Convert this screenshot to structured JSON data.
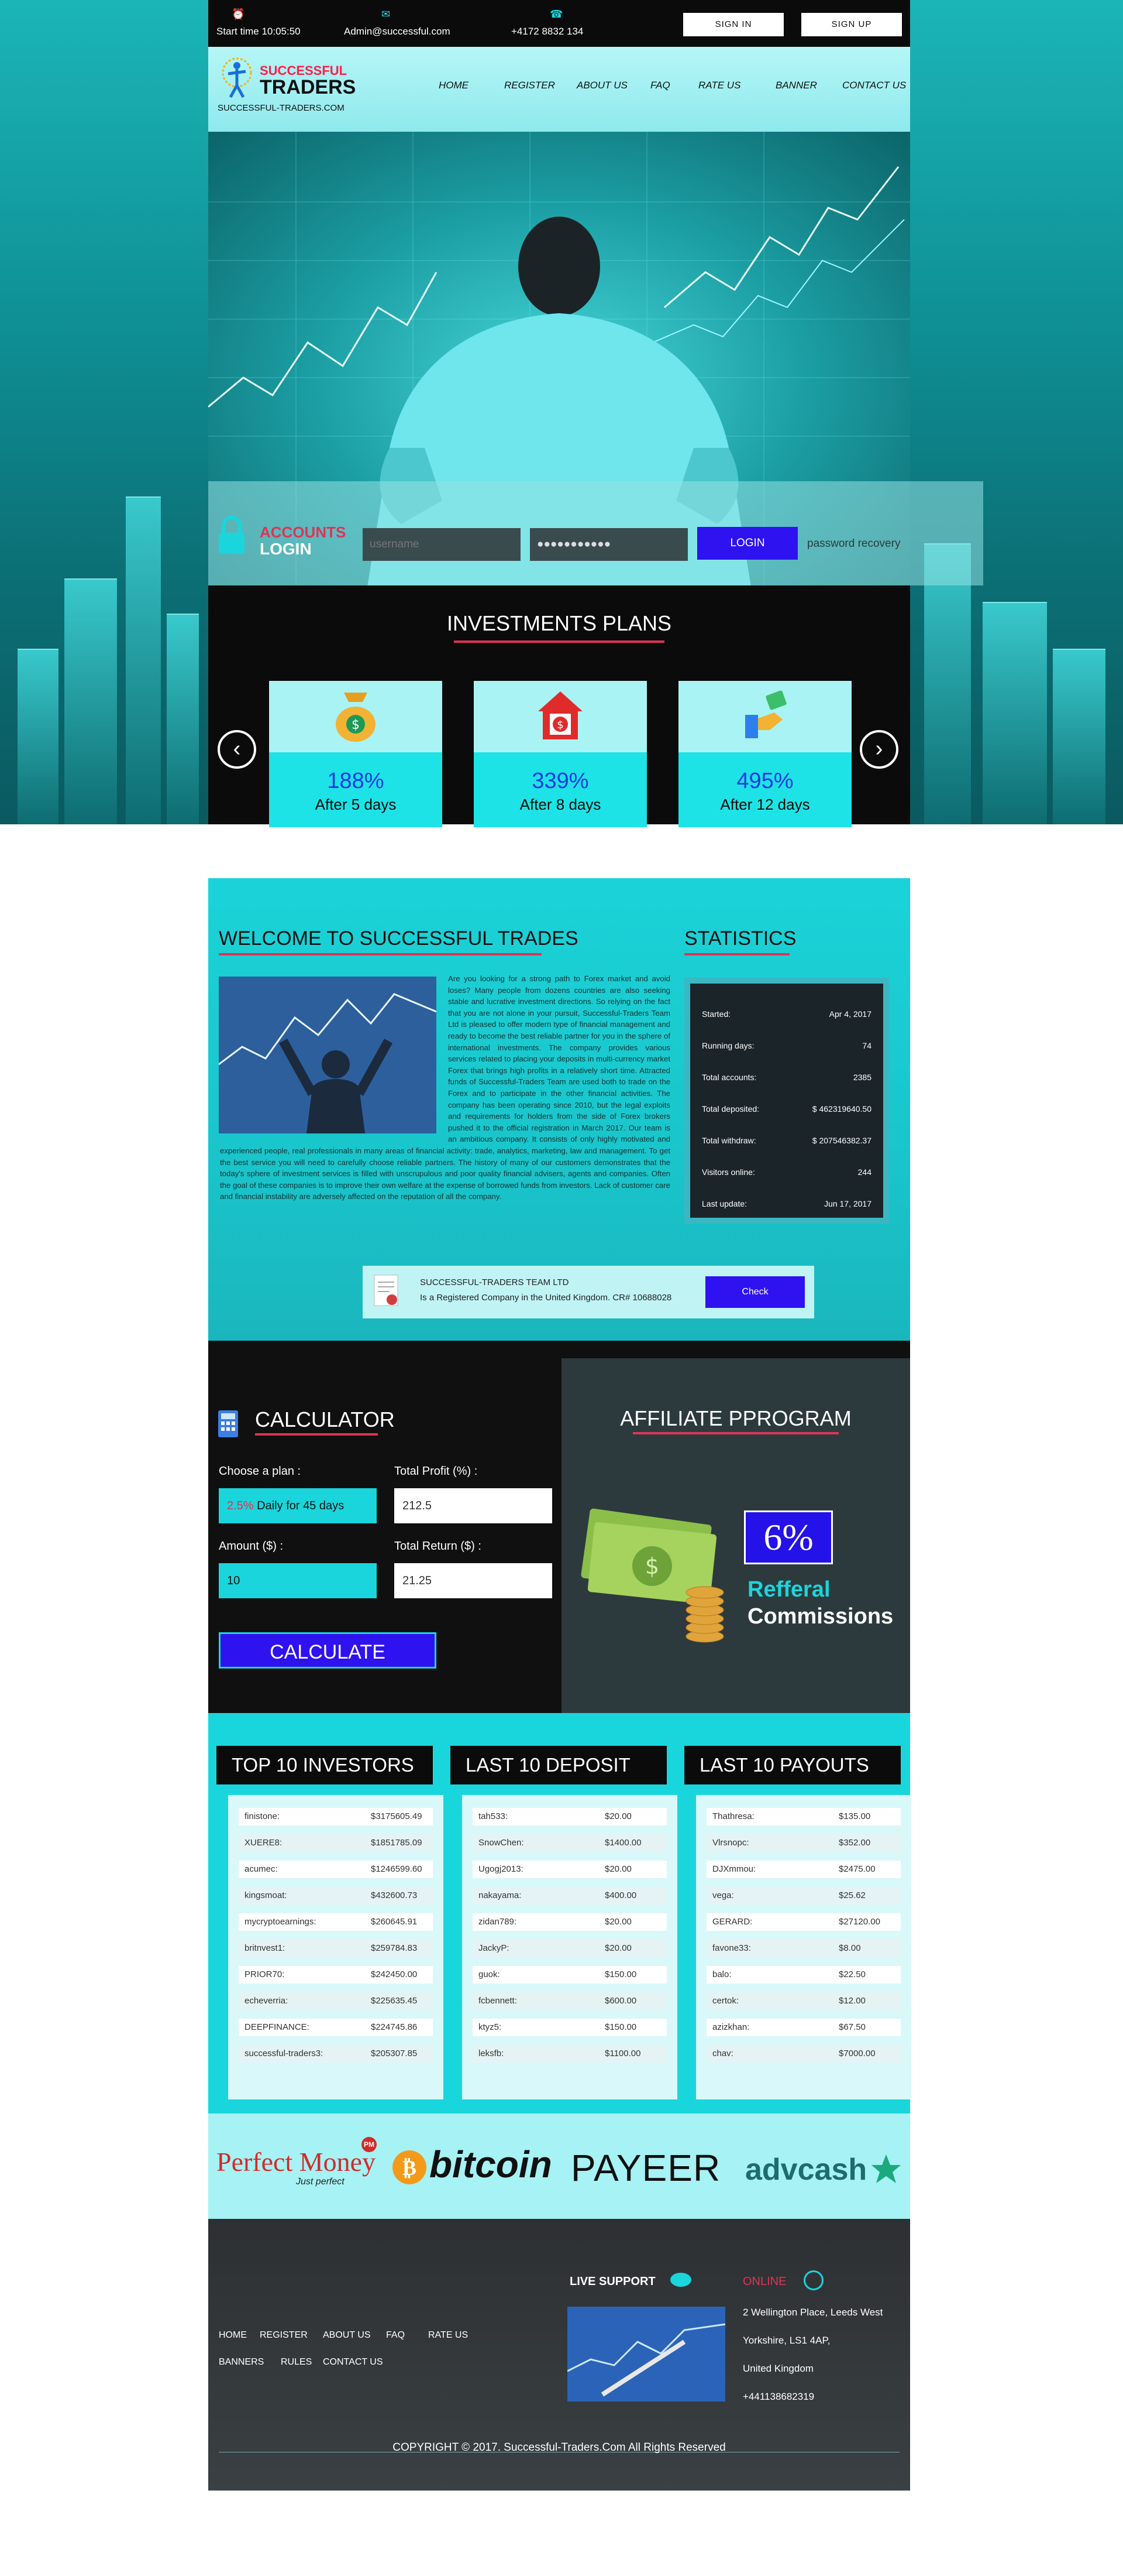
{
  "topbar": {
    "start_time": "Start time 10:05:50",
    "email": "Admin@successful.com",
    "phone": "+4172 8832 134",
    "sign_in": "SIGN IN",
    "sign_up": "SIGN UP"
  },
  "brand": {
    "line1": "SUCCESSFUL",
    "line2": "TRADERS",
    "url": "SUCCESSFUL-TRADERS.COM"
  },
  "nav": [
    "HOME",
    "REGISTER",
    "ABOUT US",
    "FAQ",
    "RATE US",
    "BANNER",
    "CONTACT US"
  ],
  "login": {
    "label1": "ACCOUNTS",
    "label2": "LOGIN",
    "username_placeholder": "username",
    "password_value": "●●●●●●●●●●●",
    "button": "LOGIN",
    "recovery": "password recovery"
  },
  "plans": {
    "title": "INVESTMENTS PLANS",
    "items": [
      {
        "percent": "188%",
        "days": "After 5 days",
        "icon": "money-bag-icon"
      },
      {
        "percent": "339%",
        "days": "After 8 days",
        "icon": "house-dollar-icon"
      },
      {
        "percent": "495%",
        "days": "After 12 days",
        "icon": "hand-money-icon"
      }
    ]
  },
  "welcome": {
    "title": "WELCOME TO SUCCESSFUL TRADES",
    "body": "Are you looking for a strong path to Forex market and avoid loses? Many people from dozens countries are also seeking stable and lucrative investment directions. So relying on the fact that you are not alone in your pursuit, Successful-Traders Team Ltd is pleased to offer modern type of financial management and ready to become the best reliable partner for you in the sphere of international investments. The company provides various services related to placing your deposits in multi-currency market Forex that brings high profits in a relatively short time. Attracted funds of Successful-Traders Team are used both to trade on the Forex and to participate in the other financial activities. The company has been operating since 2010, but the legal exploits and requirements for holders from the side of Forex brokers pushed it to the official registration in March 2017. Our team is an ambitious company. It consists of only highly motivated and experienced people, real professionals in many areas of financial activity: trade, analytics, marketing, law and management. To get the best service you will need to carefully choose reliable partners. The history of many of our customers demonstrates that the today's sphere of investment services is filled with unscrupulous and poor quality financial advisers, agents and companies. Often the goal of these companies is to improve their own welfare at the expense of borrowed funds from investors. Lack of customer care and financial instability are adversely affected on the reputation of all the company."
  },
  "statistics": {
    "title": "STATISTICS",
    "rows": [
      {
        "label": "Started:",
        "value": "Apr 4, 2017"
      },
      {
        "label": "Running days:",
        "value": "74"
      },
      {
        "label": "Total accounts:",
        "value": "2385"
      },
      {
        "label": "Total deposited:",
        "value": "$ 462319640.50"
      },
      {
        "label": "Total withdraw:",
        "value": "$ 207546382.37"
      },
      {
        "label": "Visitors online:",
        "value": "244"
      },
      {
        "label": "Last update:",
        "value": "Jun 17, 2017"
      }
    ]
  },
  "registration": {
    "company": "SUCCESSFUL-TRADERS TEAM LTD",
    "text": "Is a Registered Company in the United Kingdom. CR# 10688028",
    "button": "Check"
  },
  "calculator": {
    "title": "CALCULATOR",
    "plan_label": "Choose a plan :",
    "plan_pct": "2.5%",
    "plan_value": "Daily for 45 days",
    "profit_label": "Total Profit (%) :",
    "profit_value": "212.5",
    "amount_label": "Amount ($) :",
    "amount_value": "10",
    "return_label": "Total Return ($) :",
    "return_value": "21.25",
    "button": "CALCULATE"
  },
  "affiliate": {
    "title": "AFFILIATE PPROGRAM",
    "percent": "6%",
    "line1": "Refferal",
    "line2": "Commissions"
  },
  "investors": {
    "title": "TOP 10 INVESTORS",
    "rows": [
      [
        "finistone:",
        "$3175605.49"
      ],
      [
        "XUERE8:",
        "$1851785.09"
      ],
      [
        "acumec:",
        "$1246599.60"
      ],
      [
        "kingsmoat:",
        "$432600.73"
      ],
      [
        "mycryptoearnings:",
        "$260645.91"
      ],
      [
        "britnvest1:",
        "$259784.83"
      ],
      [
        "PRIOR70:",
        "$242450.00"
      ],
      [
        "echeverria:",
        "$225635.45"
      ],
      [
        "DEEPFINANCE:",
        "$224745.86"
      ],
      [
        "successful-traders3:",
        "$205307.85"
      ]
    ]
  },
  "deposits": {
    "title": "LAST 10 DEPOSIT",
    "rows": [
      [
        "tah533:",
        "$20.00"
      ],
      [
        "SnowChen:",
        "$1400.00"
      ],
      [
        "Ugogj2013:",
        "$20.00"
      ],
      [
        "nakayama:",
        "$400.00"
      ],
      [
        "zidan789:",
        "$20.00"
      ],
      [
        "JackyP:",
        "$20.00"
      ],
      [
        "guok:",
        "$150.00"
      ],
      [
        "fcbennett:",
        "$600.00"
      ],
      [
        "ktyz5:",
        "$150.00"
      ],
      [
        "leksfb:",
        "$1100.00"
      ]
    ]
  },
  "payouts": {
    "title": "LAST 10 PAYOUTS",
    "rows": [
      [
        "Thathresa:",
        "$135.00"
      ],
      [
        "Vlrsnopc:",
        "$352.00"
      ],
      [
        "DJXmmou:",
        "$2475.00"
      ],
      [
        "vega:",
        "$25.62"
      ],
      [
        "GERARD:",
        "$27120.00"
      ],
      [
        "favone33:",
        "$8.00"
      ],
      [
        "balo:",
        "$22.50"
      ],
      [
        "certok:",
        "$12.00"
      ],
      [
        "azizkhan:",
        "$67.50"
      ],
      [
        "chav:",
        "$7000.00"
      ]
    ]
  },
  "payments": {
    "perfect_money": "Perfect Money",
    "perfect_money_tag": "Just perfect",
    "pm_badge": "PM",
    "bitcoin": "bitcoin",
    "payeer": "PAYEER",
    "advcash": "advcash"
  },
  "footer": {
    "links_row1": [
      "HOME",
      "REGISTER",
      "ABOUT US",
      "FAQ",
      "RATE US"
    ],
    "links_row2": [
      "BANNERS",
      "RULES",
      "CONTACT US"
    ],
    "live_support": "LIVE SUPPORT",
    "online": "ONLINE",
    "address1": "2 Wellington Place, Leeds West",
    "address2": "Yorkshire, LS1 4AP,",
    "address3": "United Kingdom",
    "phone": "+441138682319",
    "copyright": "COPYRIGHT © 2017. Successful-Traders.Com All Rights Reserved"
  },
  "colors": {
    "accent": "#1ad5dc",
    "brand_red": "#e03356",
    "button_blue": "#2f12f0"
  }
}
